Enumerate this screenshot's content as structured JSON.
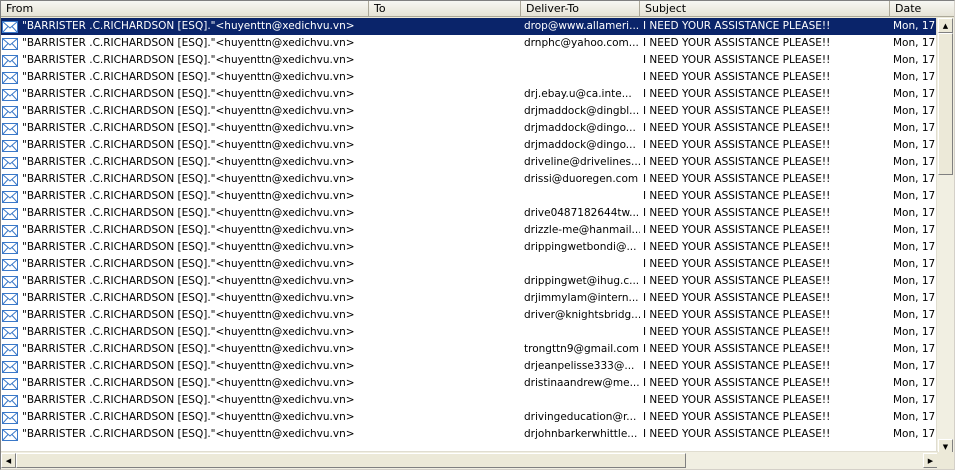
{
  "columns": {
    "from": "From",
    "to": "To",
    "deliver_to": "Deliver-To",
    "subject": "Subject",
    "date": "Date"
  },
  "icons": {
    "row_icon": "email-envelope-icon",
    "scroll_up": "arrow-up-icon",
    "scroll_down": "arrow-down-icon",
    "scroll_left": "arrow-left-icon",
    "scroll_right": "arrow-right-icon"
  },
  "colors": {
    "selection": "#0a246a",
    "envelope": "#3a78c8"
  },
  "rows": [
    {
      "from": "\"BARRISTER .C.RICHARDSON [ESQ].\"<huyenttn@xedichvu.vn>",
      "to": "",
      "deliver_to": "drop@www.allameri...",
      "subject": "I NEED YOUR ASSISTANCE PLEASE!!",
      "date": "Mon, 17",
      "selected": true
    },
    {
      "from": "\"BARRISTER .C.RICHARDSON [ESQ].\"<huyenttn@xedichvu.vn>",
      "to": "",
      "deliver_to": "drnphc@yahoo.com...",
      "subject": "I NEED YOUR ASSISTANCE PLEASE!!",
      "date": "Mon, 17"
    },
    {
      "from": "\"BARRISTER .C.RICHARDSON [ESQ].\"<huyenttn@xedichvu.vn>",
      "to": "",
      "deliver_to": "",
      "subject": "I NEED YOUR ASSISTANCE PLEASE!!",
      "date": "Mon, 17"
    },
    {
      "from": "\"BARRISTER .C.RICHARDSON [ESQ].\"<huyenttn@xedichvu.vn>",
      "to": "",
      "deliver_to": "",
      "subject": "I NEED YOUR ASSISTANCE PLEASE!!",
      "date": "Mon, 17"
    },
    {
      "from": "\"BARRISTER .C.RICHARDSON [ESQ].\"<huyenttn@xedichvu.vn>",
      "to": "",
      "deliver_to": "drj.ebay.u@ca.inte...",
      "subject": "I NEED YOUR ASSISTANCE PLEASE!!",
      "date": "Mon, 17"
    },
    {
      "from": "\"BARRISTER .C.RICHARDSON [ESQ].\"<huyenttn@xedichvu.vn>",
      "to": "",
      "deliver_to": "drjmaddock@dingbl...",
      "subject": "I NEED YOUR ASSISTANCE PLEASE!!",
      "date": "Mon, 17"
    },
    {
      "from": "\"BARRISTER .C.RICHARDSON [ESQ].\"<huyenttn@xedichvu.vn>",
      "to": "",
      "deliver_to": "drjmaddock@dingo...",
      "subject": "I NEED YOUR ASSISTANCE PLEASE!!",
      "date": "Mon, 17"
    },
    {
      "from": "\"BARRISTER .C.RICHARDSON [ESQ].\"<huyenttn@xedichvu.vn>",
      "to": "",
      "deliver_to": "drjmaddock@dingo...",
      "subject": "I NEED YOUR ASSISTANCE PLEASE!!",
      "date": "Mon, 17"
    },
    {
      "from": "\"BARRISTER .C.RICHARDSON [ESQ].\"<huyenttn@xedichvu.vn>",
      "to": "",
      "deliver_to": "driveline@drivelines...",
      "subject": "I NEED YOUR ASSISTANCE PLEASE!!",
      "date": "Mon, 17"
    },
    {
      "from": "\"BARRISTER .C.RICHARDSON [ESQ].\"<huyenttn@xedichvu.vn>",
      "to": "",
      "deliver_to": "drissi@duoregen.com",
      "subject": "I NEED YOUR ASSISTANCE PLEASE!!",
      "date": "Mon, 17"
    },
    {
      "from": "\"BARRISTER .C.RICHARDSON [ESQ].\"<huyenttn@xedichvu.vn>",
      "to": "",
      "deliver_to": "",
      "subject": "I NEED YOUR ASSISTANCE PLEASE!!",
      "date": "Mon, 17"
    },
    {
      "from": "\"BARRISTER .C.RICHARDSON [ESQ].\"<huyenttn@xedichvu.vn>",
      "to": "",
      "deliver_to": "drive0487182644tw...",
      "subject": "I NEED YOUR ASSISTANCE PLEASE!!",
      "date": "Mon, 17"
    },
    {
      "from": "\"BARRISTER .C.RICHARDSON [ESQ].\"<huyenttn@xedichvu.vn>",
      "to": "",
      "deliver_to": "drizzle-me@hanmail...",
      "subject": "I NEED YOUR ASSISTANCE PLEASE!!",
      "date": "Mon, 17"
    },
    {
      "from": "\"BARRISTER .C.RICHARDSON [ESQ].\"<huyenttn@xedichvu.vn>",
      "to": "",
      "deliver_to": "drippingwetbondi@...",
      "subject": "I NEED YOUR ASSISTANCE PLEASE!!",
      "date": "Mon, 17"
    },
    {
      "from": "\"BARRISTER .C.RICHARDSON [ESQ].\"<huyenttn@xedichvu.vn>",
      "to": "",
      "deliver_to": "",
      "subject": "I NEED YOUR ASSISTANCE PLEASE!!",
      "date": "Mon, 17"
    },
    {
      "from": "\"BARRISTER .C.RICHARDSON [ESQ].\"<huyenttn@xedichvu.vn>",
      "to": "",
      "deliver_to": "drippingwet@ihug.c...",
      "subject": "I NEED YOUR ASSISTANCE PLEASE!!",
      "date": "Mon, 17"
    },
    {
      "from": "\"BARRISTER .C.RICHARDSON [ESQ].\"<huyenttn@xedichvu.vn>",
      "to": "",
      "deliver_to": "drjimmylam@intern...",
      "subject": "I NEED YOUR ASSISTANCE PLEASE!!",
      "date": "Mon, 17"
    },
    {
      "from": "\"BARRISTER .C.RICHARDSON [ESQ].\"<huyenttn@xedichvu.vn>",
      "to": "",
      "deliver_to": "driver@knightsbridg...",
      "subject": "I NEED YOUR ASSISTANCE PLEASE!!",
      "date": "Mon, 17"
    },
    {
      "from": "\"BARRISTER .C.RICHARDSON [ESQ].\"<huyenttn@xedichvu.vn>",
      "to": "",
      "deliver_to": "",
      "subject": "I NEED YOUR ASSISTANCE PLEASE!!",
      "date": "Mon, 17"
    },
    {
      "from": "\"BARRISTER .C.RICHARDSON [ESQ].\"<huyenttn@xedichvu.vn>",
      "to": "",
      "deliver_to": "trongttn9@gmail.com",
      "subject": "I NEED YOUR ASSISTANCE PLEASE!!",
      "date": "Mon, 17"
    },
    {
      "from": "\"BARRISTER .C.RICHARDSON [ESQ].\"<huyenttn@xedichvu.vn>",
      "to": "",
      "deliver_to": "drjeanpelisse333@...",
      "subject": "I NEED YOUR ASSISTANCE PLEASE!!",
      "date": "Mon, 17"
    },
    {
      "from": "\"BARRISTER .C.RICHARDSON [ESQ].\"<huyenttn@xedichvu.vn>",
      "to": "",
      "deliver_to": "dristinaandrew@me...",
      "subject": "I NEED YOUR ASSISTANCE PLEASE!!",
      "date": "Mon, 17"
    },
    {
      "from": "\"BARRISTER .C.RICHARDSON [ESQ].\"<huyenttn@xedichvu.vn>",
      "to": "",
      "deliver_to": "",
      "subject": "I NEED YOUR ASSISTANCE PLEASE!!",
      "date": "Mon, 17"
    },
    {
      "from": "\"BARRISTER .C.RICHARDSON [ESQ].\"<huyenttn@xedichvu.vn>",
      "to": "",
      "deliver_to": "drivingeducation@r...",
      "subject": "I NEED YOUR ASSISTANCE PLEASE!!",
      "date": "Mon, 17"
    },
    {
      "from": "\"BARRISTER .C.RICHARDSON [ESQ].\"<huyenttn@xedichvu.vn>",
      "to": "",
      "deliver_to": "drjohnbarkerwhittle...",
      "subject": "I NEED YOUR ASSISTANCE PLEASE!!",
      "date": "Mon, 17"
    }
  ]
}
